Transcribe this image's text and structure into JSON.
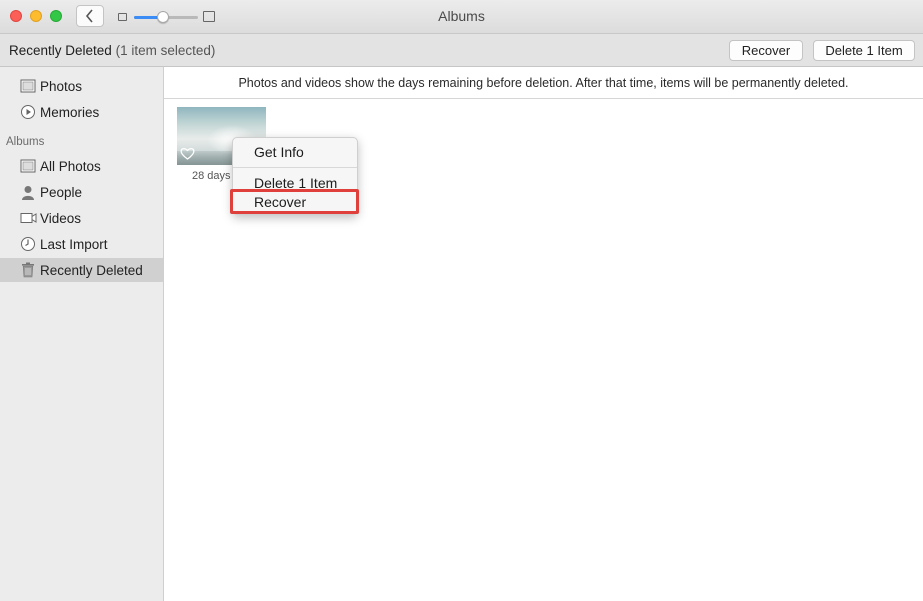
{
  "window": {
    "title": "Albums"
  },
  "toolbar": {
    "title": "Recently Deleted",
    "selection": "(1 item selected)",
    "recover_label": "Recover",
    "delete_label": "Delete 1 Item"
  },
  "zoom_slider": {
    "level": 0.45
  },
  "sidebar": {
    "items_top": [
      {
        "label": "Photos",
        "icon": "photos-icon"
      },
      {
        "label": "Memories",
        "icon": "memories-icon"
      }
    ],
    "albums_heading": "Albums",
    "albums": [
      {
        "label": "All Photos",
        "icon": "all-photos-icon"
      },
      {
        "label": "People",
        "icon": "people-icon"
      },
      {
        "label": "Videos",
        "icon": "videos-icon"
      },
      {
        "label": "Last Import",
        "icon": "clock-icon"
      },
      {
        "label": "Recently Deleted",
        "icon": "trash-icon",
        "selected": true
      }
    ]
  },
  "banner": {
    "text": "Photos and videos show the days remaining before deletion. After that time, items will be permanently deleted."
  },
  "grid": {
    "items": [
      {
        "days_label": "28 days"
      }
    ]
  },
  "context_menu": {
    "items": [
      "Get Info",
      "Delete 1 Item",
      "Recover"
    ],
    "highlighted": "Recover"
  },
  "colors": {
    "accent": "#3b8cf5",
    "highlight_border": "#e0403c",
    "selected_row": "#d0d0d0"
  }
}
